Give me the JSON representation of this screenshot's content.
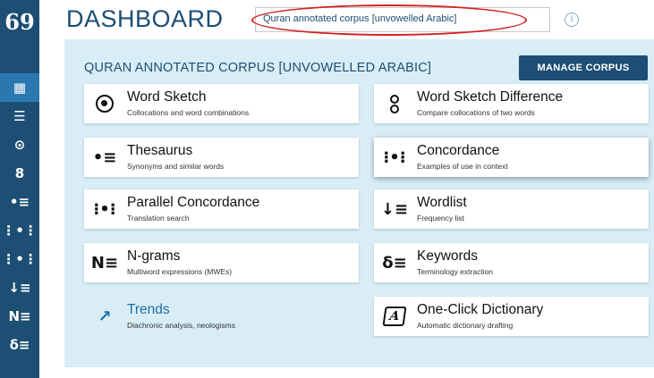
{
  "sidebar": {
    "logo": "69",
    "items": [
      {
        "icon": "dashboard-grid-icon",
        "glyph": "▦",
        "active": true
      },
      {
        "icon": "list-icon",
        "glyph": "☰",
        "active": false
      },
      {
        "icon": "word-sketch-icon",
        "glyph": "⊙",
        "active": false
      },
      {
        "icon": "word-sketch-difference-icon",
        "glyph": "8",
        "active": false
      },
      {
        "icon": "thesaurus-icon",
        "glyph": "•≡",
        "active": false
      },
      {
        "icon": "concordance-icon",
        "glyph": "⋮•⋮",
        "active": false
      },
      {
        "icon": "parallel-concordance-icon",
        "glyph": "⋮•⋮",
        "active": false
      },
      {
        "icon": "wordlist-icon",
        "glyph": "↓≡",
        "active": false
      },
      {
        "icon": "ngrams-icon",
        "glyph": "N≡",
        "active": false
      },
      {
        "icon": "keywords-icon",
        "glyph": "δ≡",
        "active": false
      }
    ]
  },
  "header": {
    "title": "DASHBOARD",
    "corpus_selector_value": "Quran annotated corpus [unvowelled Arabic]",
    "info_glyph": "i"
  },
  "panel": {
    "corpus_name": "QURAN ANNOTATED CORPUS [UNVOWELLED ARABIC]",
    "manage_button": "MANAGE CORPUS",
    "cards": [
      {
        "title": "Word Sketch",
        "desc": "Collocations and word combinations",
        "icon": "word-sketch-icon",
        "glyph": ""
      },
      {
        "title": "Word Sketch Difference",
        "desc": "Compare collocations of two words",
        "icon": "word-sketch-difference-icon",
        "glyph": ""
      },
      {
        "title": "Thesaurus",
        "desc": "Synonyms and similar words",
        "icon": "thesaurus-icon",
        "glyph": "•≡"
      },
      {
        "title": "Concordance",
        "desc": "Examples of use in context",
        "icon": "concordance-icon",
        "glyph": "⁝•⁝"
      },
      {
        "title": "Parallel Concordance",
        "desc": "Translation search",
        "icon": "parallel-concordance-icon",
        "glyph": "⁝•⁝"
      },
      {
        "title": "Wordlist",
        "desc": "Frequency list",
        "icon": "wordlist-icon",
        "glyph": "↓≡"
      },
      {
        "title": "N-grams",
        "desc": "Multiword expressions (MWEs)",
        "icon": "ngrams-icon",
        "glyph": "N≡"
      },
      {
        "title": "Keywords",
        "desc": "Terminology extraction",
        "icon": "keywords-icon",
        "glyph": "δ≡"
      },
      {
        "title": "Trends",
        "desc": "Diachronic analysis, neologisms",
        "icon": "trends-icon",
        "glyph": "↗"
      },
      {
        "title": "One-Click Dictionary",
        "desc": "Automatic dictionary drafting",
        "icon": "dictionary-book-icon",
        "glyph": "A"
      }
    ]
  },
  "colors": {
    "primary": "#1d4e73",
    "sidebar_active": "#2b78b0",
    "panel_bg": "#d8edf6",
    "highlight": "#d32020",
    "link": "#1d6fa3"
  }
}
